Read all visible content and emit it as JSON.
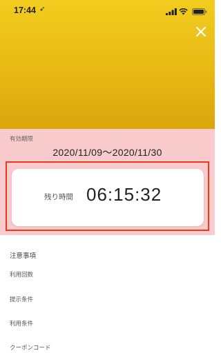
{
  "status_bar": {
    "time": "17:44",
    "location_glyph": "➶",
    "icons": [
      "signal-icon",
      "wifi-icon",
      "battery-icon"
    ]
  },
  "header": {
    "close_icon": "close-icon",
    "hero_color": "#e8b914"
  },
  "validity": {
    "label": "有効期限",
    "range": "2020/11/09〜2020/11/30",
    "remaining_label": "残り時間",
    "remaining_time": "06:15:32",
    "highlight_color": "#e83a1f",
    "background": "#f9cbcd"
  },
  "notes": {
    "title": "注意事項",
    "items": [
      "利用回数",
      "提示条件",
      "利用条件",
      "クーポンコード"
    ]
  }
}
